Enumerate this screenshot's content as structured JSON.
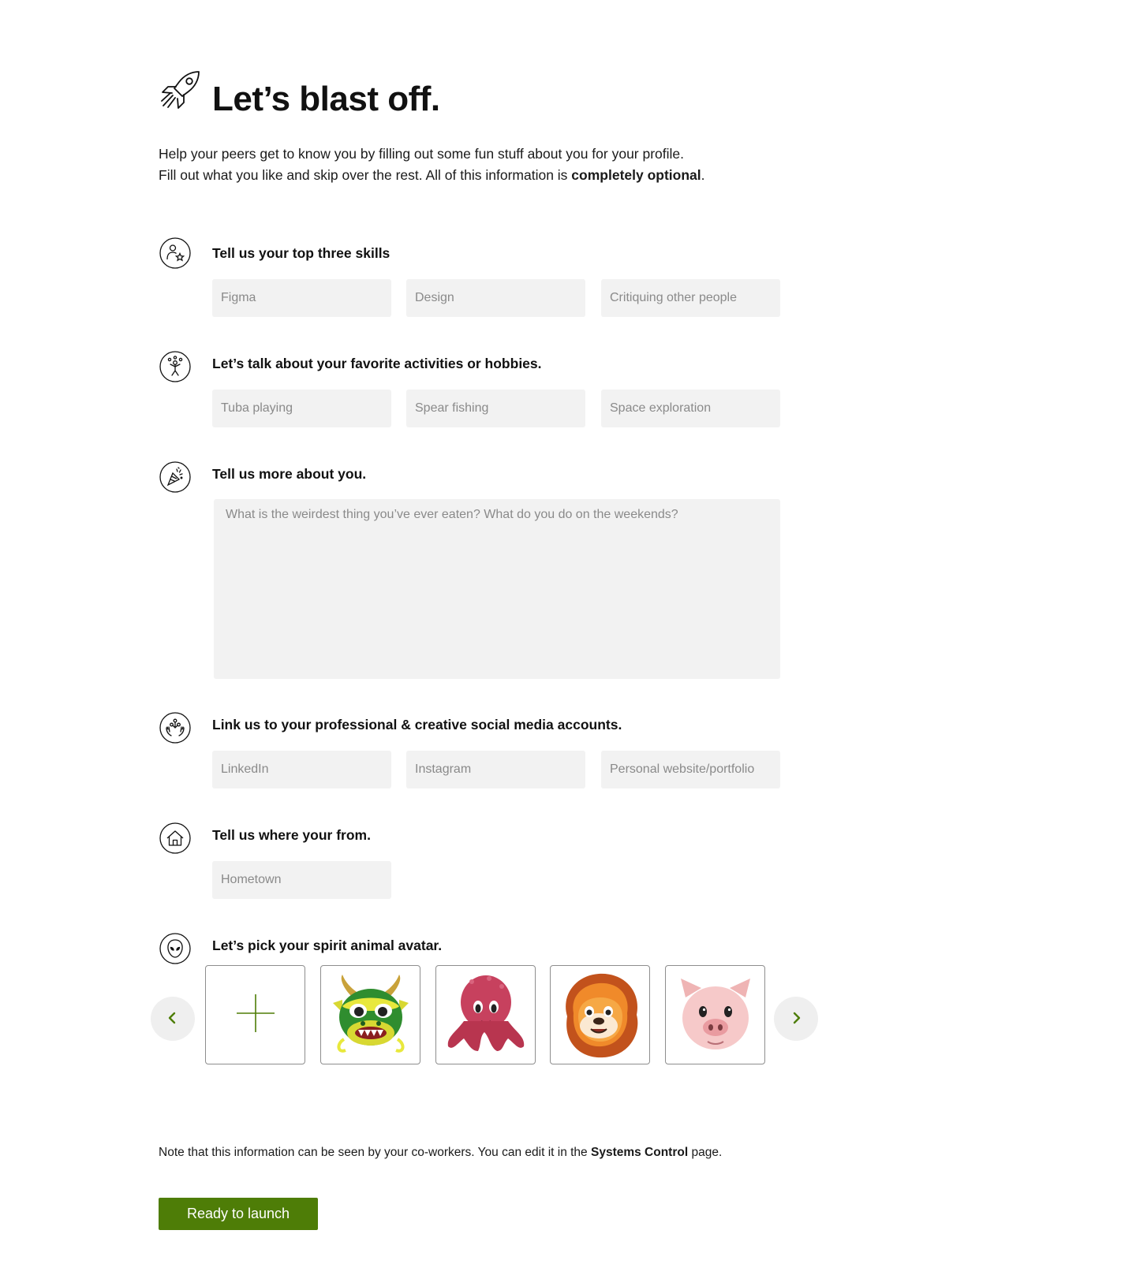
{
  "header": {
    "title": "Let’s blast off.",
    "intro_line1": "Help your peers get to know you by filling out some fun stuff about you for your profile.",
    "intro_line2_start": "Fill out what you like and skip over the rest. All of this information is ",
    "intro_line2_bold": "completely optional",
    "intro_line2_end": "."
  },
  "sections": {
    "skills": {
      "label": "Tell us your top three skills",
      "icon": "person-star-icon",
      "fields": [
        {
          "placeholder": "Figma"
        },
        {
          "placeholder": "Design"
        },
        {
          "placeholder": "Critiquing other people"
        }
      ]
    },
    "hobbies": {
      "label": "Let’s talk about your favorite activities or hobbies.",
      "icon": "juggler-icon",
      "fields": [
        {
          "placeholder": "Tuba playing"
        },
        {
          "placeholder": "Spear fishing"
        },
        {
          "placeholder": "Space exploration"
        }
      ]
    },
    "about": {
      "label": "Tell us more about you.",
      "icon": "party-popper-icon",
      "placeholder": "What is the weirdest thing you’ve ever eaten? What do you do on the weekends?"
    },
    "social": {
      "label": "Link us to your professional & creative social media accounts.",
      "icon": "hands-network-icon",
      "fields": [
        {
          "placeholder": "LinkedIn"
        },
        {
          "placeholder": "Instagram"
        },
        {
          "placeholder": "Personal website/portfolio"
        }
      ]
    },
    "hometown": {
      "label": "Tell us where your from.",
      "icon": "house-icon",
      "fields": [
        {
          "placeholder": "Hometown"
        }
      ]
    },
    "avatar": {
      "label": "Let’s pick your spirit animal avatar.",
      "icon": "alien-face-icon",
      "options": [
        "add-avatar",
        "dragon",
        "octopus",
        "lion",
        "pig"
      ]
    }
  },
  "footer": {
    "note_start": "Note that this information can be seen by your co-workers. You can edit it in the ",
    "note_bold": "Systems Control",
    "note_end": " page.",
    "button_label": "Ready to launch"
  },
  "colors": {
    "accent": "#4e7d07",
    "field_bg": "#f2f2f2",
    "nav_bg": "#efefef"
  }
}
